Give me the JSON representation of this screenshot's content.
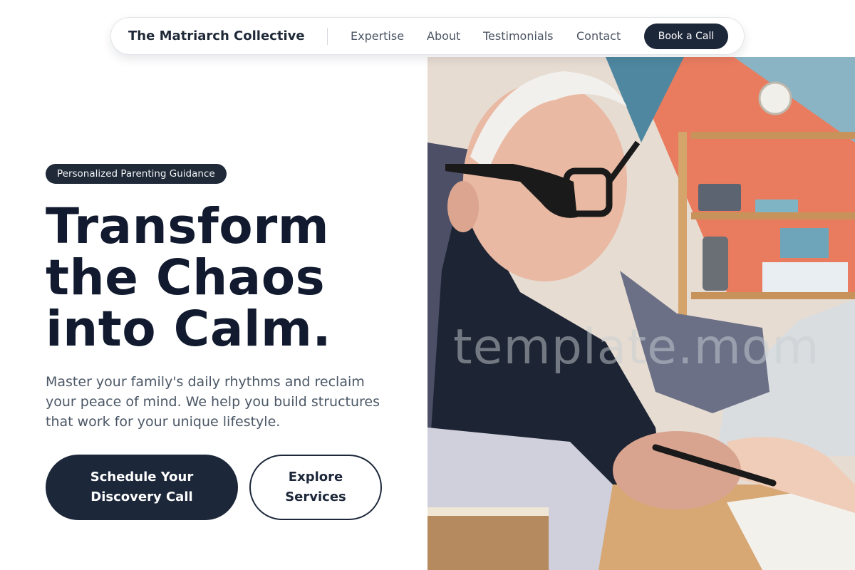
{
  "nav": {
    "brand": "The Matriarch Collective",
    "links": [
      "Expertise",
      "About",
      "Testimonials",
      "Contact"
    ],
    "cta_label": "Book a Call"
  },
  "hero": {
    "badge": "Personalized Parenting Guidance",
    "headline_lines": [
      "Transform",
      "the Chaos",
      "into Calm."
    ],
    "subtext": "Master your family's daily rhythms and reclaim your peace of mind. We help you build structures that work for your unique lifestyle.",
    "primary_cta": "Schedule Your Discovery Call",
    "secondary_cta": "Explore Services"
  },
  "image": {
    "description_icon": "photo-grandfather-helping-child",
    "watermark": "template.mom"
  },
  "colors": {
    "primary": "#1d273a",
    "heading": "#111a2e",
    "body_text": "#4b5766",
    "background": "#ffffff"
  }
}
